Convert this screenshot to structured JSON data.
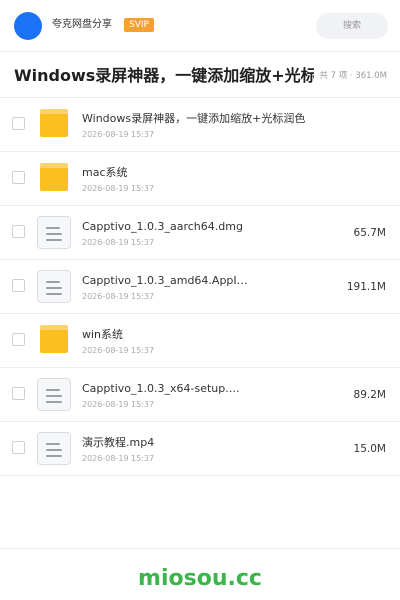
{
  "topbar": {
    "site_name": "夸克网盘分享",
    "badge": "SVIP",
    "search_placeholder": "搜索"
  },
  "folder": {
    "title": "Windows录屏神器，一键添加缩放+光标润色",
    "meta": "共 7 项 · 361.0M"
  },
  "files": [
    {
      "type": "folder",
      "name": "Windows录屏神器，一键添加缩放+光标润色",
      "date": "2026-08-19 15:37",
      "size": ""
    },
    {
      "type": "folder",
      "name": "mac系统",
      "date": "2026-08-19 15:37",
      "size": ""
    },
    {
      "type": "file",
      "name": "Capptivo_1.0.3_aarch64.dmg",
      "date": "2026-08-19 15:37",
      "size": "65.7M"
    },
    {
      "type": "file",
      "name": "Capptivo_1.0.3_amd64.AppI…",
      "date": "2026-08-19 15:37",
      "size": "191.1M"
    },
    {
      "type": "folder",
      "name": "win系统",
      "date": "2026-08-19 15:37",
      "size": ""
    },
    {
      "type": "file",
      "name": "Capptivo_1.0.3_x64-setup.…",
      "date": "2026-08-19 15:37",
      "size": "89.2M"
    },
    {
      "type": "file",
      "name": "演示教程.mp4",
      "date": "2026-08-19 15:37",
      "size": "15.0M"
    }
  ],
  "footer": {
    "brand": "miosou.cc"
  },
  "colors": {
    "avatar": "#1a73f5",
    "svip_badge": "#f5a031",
    "folder": "#fcbf20",
    "brand": "#3cb54a"
  },
  "icons": {
    "folder": "folder-icon",
    "file": "file-document-icon"
  }
}
